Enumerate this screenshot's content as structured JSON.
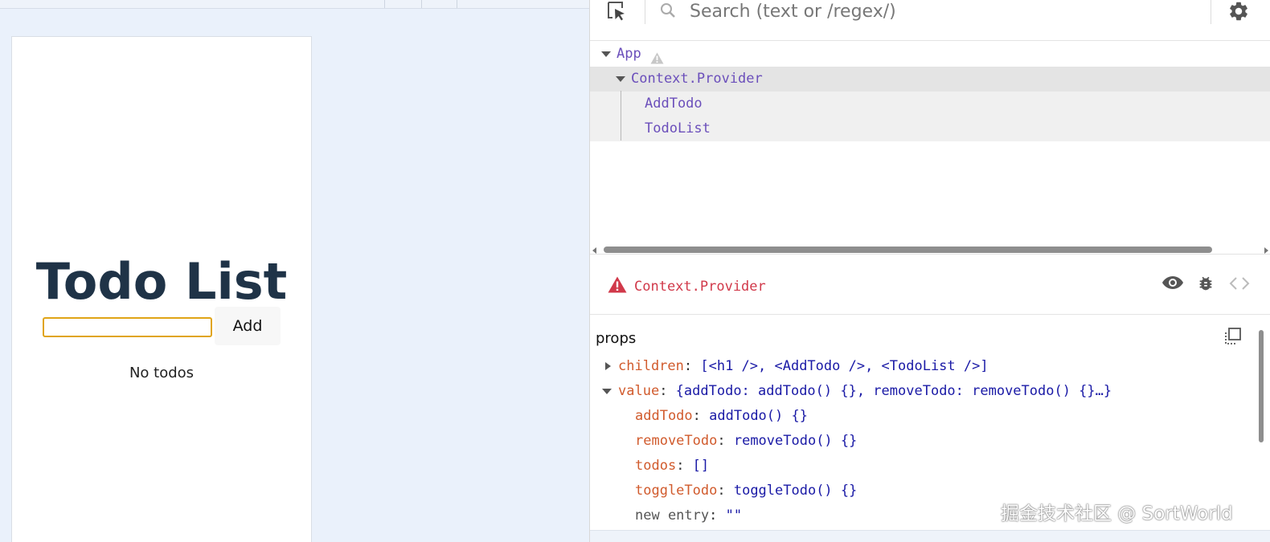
{
  "app": {
    "title": "Todo List",
    "input_value": "",
    "add_label": "Add",
    "empty_text": "No todos"
  },
  "devtools": {
    "search_placeholder": "Search (text or /regex/)",
    "tree": [
      {
        "name": "App",
        "warning": true,
        "expanded": true,
        "depth": 0
      },
      {
        "name": "Context.Provider",
        "selected": true,
        "expanded": true,
        "depth": 1
      },
      {
        "name": "AddTodo",
        "depth": 2
      },
      {
        "name": "TodoList",
        "depth": 2
      }
    ],
    "selected_component": "Context.Provider",
    "props_title": "props",
    "props": {
      "children": {
        "key": "children",
        "value": "[<h1 />, <AddTodo />, <TodoList />]"
      },
      "value": {
        "key": "value",
        "value": "{addTodo: addTodo() {}, removeTodo: removeTodo() {}…}"
      },
      "value_children": [
        {
          "key": "addTodo",
          "value": "addTodo() {}"
        },
        {
          "key": "removeTodo",
          "value": "removeTodo() {}"
        },
        {
          "key": "todos",
          "value": "[]"
        },
        {
          "key": "toggleTodo",
          "value": "toggleTodo() {}"
        },
        {
          "key": "new entry",
          "value": "\"\""
        }
      ]
    },
    "icons": {
      "inspect": "inspect-element-icon",
      "search": "search-icon",
      "settings": "gear-icon",
      "warning": "warning-icon",
      "eye": "eye-icon",
      "bug": "bug-icon",
      "source": "code-icon",
      "copy": "copy-icon"
    },
    "colors": {
      "component_name": "#6b4fbb",
      "prop_key": "#d15b2d",
      "prop_value": "#1a1aa6",
      "warning": "#d1394a"
    }
  },
  "watermark": "掘金技术社区 @ SortWorld"
}
